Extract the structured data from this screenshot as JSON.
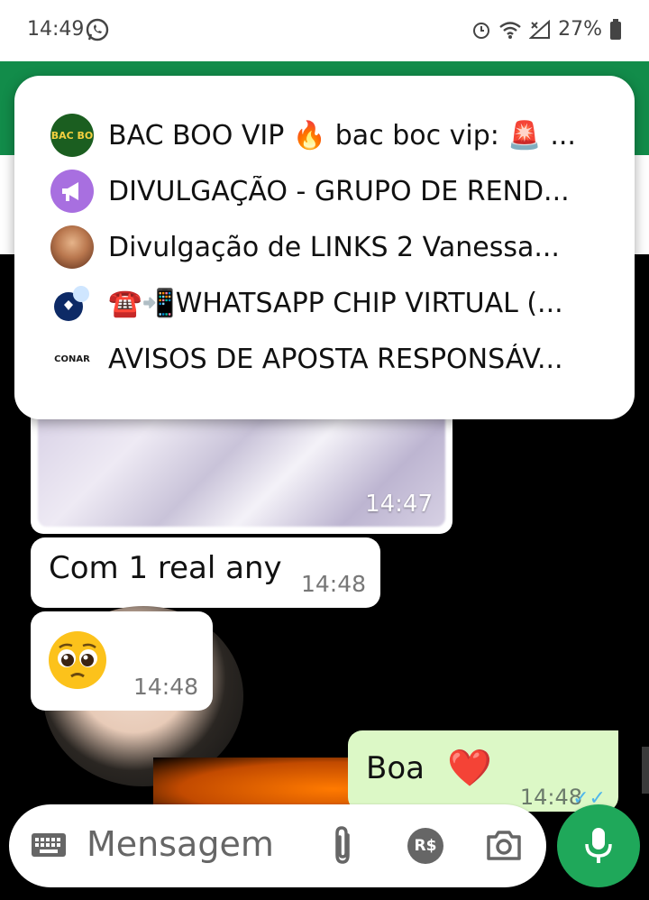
{
  "status_bar": {
    "time": "14:49",
    "battery": "27%"
  },
  "popup": {
    "items": [
      {
        "label": "BAC BOO VIP 🔥 bac boc vip: 🚨 ...",
        "avatar_text": "BAC BO",
        "avatar_color": "#1b5e20"
      },
      {
        "label": "DIVULGAÇÃO - GRUPO DE REND...",
        "avatar_icon": "megaphone-icon",
        "avatar_color": "#a86fe0"
      },
      {
        "label": "Divulgação de LINKS 2 Vanessa...",
        "avatar_color": "#b9774e"
      },
      {
        "label": "☎️📲WHATSAPP CHIP VIRTUAL (...",
        "avatar_color": "#0d2a66"
      },
      {
        "label": "AVISOS DE APOSTA RESPONSÁV...",
        "avatar_text": "CONAR",
        "avatar_color": "#ffffff"
      }
    ]
  },
  "messages": {
    "image_time": "14:47",
    "msg1_text": "Com 1 real any",
    "msg1_time": "14:48",
    "msg2_emoji": "🥺",
    "msg2_time": "14:48",
    "out_text": "Boa",
    "out_emoji": "❤️",
    "out_time": "14:48"
  },
  "composer": {
    "placeholder": "Mensagem",
    "currency_label": "R$"
  },
  "colors": {
    "whatsapp_green": "#128c4a",
    "mic_green": "#1fa85a",
    "outgoing_bubble": "#dcf8c6",
    "read_ticks": "#4fb6ec"
  }
}
